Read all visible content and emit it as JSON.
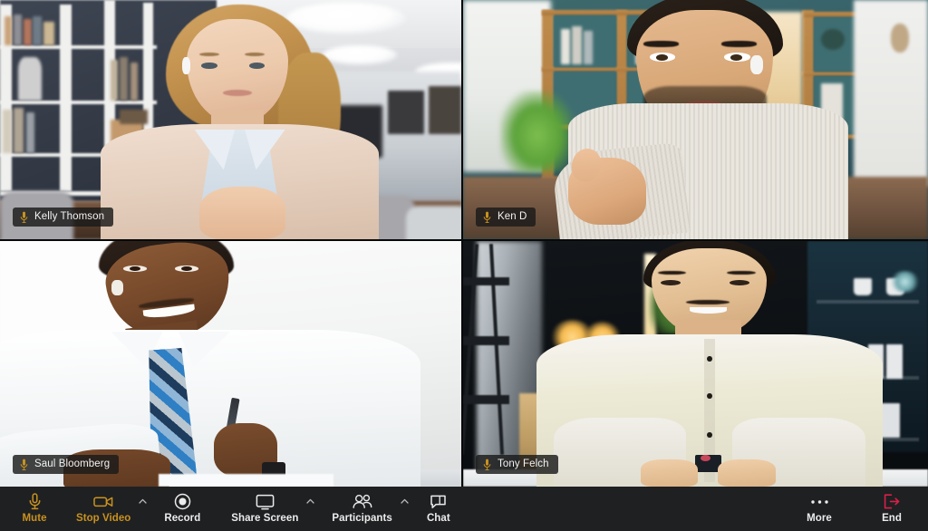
{
  "meeting": {
    "layout": "gallery-2x2",
    "participant_count": 4
  },
  "tiles": [
    {
      "id": "tile-kelly-thomson",
      "name": "Kelly Thomson",
      "mic_icon": "microphone-icon",
      "mic_state": "active",
      "scene": "blonde woman in beige blazer and light blue shirt, hands clasped, bright office with white bookshelves and dark blue wall, round ceiling lights"
    },
    {
      "id": "tile-ken-d",
      "name": "Ken D",
      "mic_icon": "microphone-icon",
      "mic_state": "active",
      "scene": "man with dark curly hair and beard pointing at camera, striped light shirt, teal room with wooden bookcases and leather sofa"
    },
    {
      "id": "tile-saul-bloomberg",
      "name": "Saul Bloomberg",
      "mic_icon": "microphone-icon",
      "mic_state": "active",
      "scene": "smiling man in white shirt with blue checkered tie holding a pen, bright white background"
    },
    {
      "id": "tile-tony-felch",
      "name": "Tony Felch",
      "mic_icon": "microphone-icon",
      "mic_state": "active",
      "scene": "man in white shirt seated at a white desk, dark room with warm desk lamps and shelving"
    }
  ],
  "toolbar": {
    "background_color": "#1f2022",
    "left_items": [
      {
        "id": "mute",
        "label": "Mute",
        "icon": "microphone-icon",
        "style": "warn",
        "caret": false
      },
      {
        "id": "stop-video",
        "label": "Stop Video",
        "icon": "video-camera-icon",
        "style": "warn",
        "caret": true
      },
      {
        "id": "record",
        "label": "Record",
        "icon": "record-icon",
        "style": "plain",
        "caret": false
      },
      {
        "id": "share-screen",
        "label": "Share Screen",
        "icon": "monitor-icon",
        "style": "plain",
        "caret": true
      },
      {
        "id": "participants",
        "label": "Participants",
        "icon": "people-icon",
        "style": "plain",
        "caret": true
      },
      {
        "id": "chat",
        "label": "Chat",
        "icon": "chat-bubble-icon",
        "style": "plain",
        "caret": false
      }
    ],
    "right_items": [
      {
        "id": "more",
        "label": "More",
        "icon": "ellipsis-icon",
        "style": "plain"
      },
      {
        "id": "end",
        "label": "End",
        "icon": "exit-door-icon",
        "style": "danger"
      }
    ],
    "colors": {
      "warn_accent": "#c8921f",
      "danger_accent": "#d6204a",
      "label_default": "#ececec",
      "mic_badge_accent": "#c8921f"
    }
  }
}
